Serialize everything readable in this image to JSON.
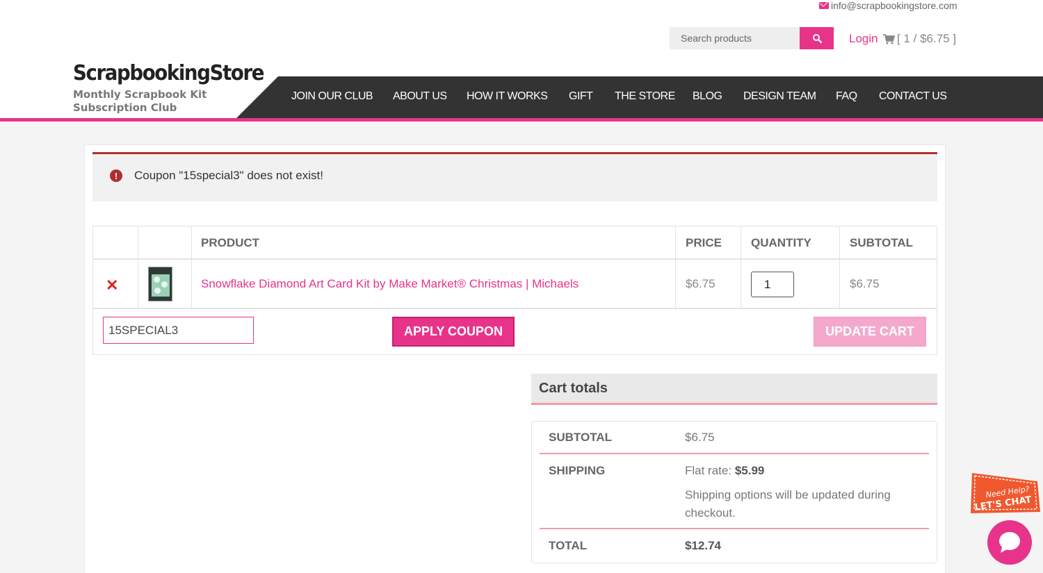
{
  "header": {
    "email": "info@scrapbookingstore.com",
    "search_placeholder": "Search products",
    "login_label": "Login",
    "cart_summary": "[ 1 / $6.75 ]",
    "logo_title": "ScrapbookingStore",
    "logo_subtitle": "Monthly Scrapbook Kit Subscription Club"
  },
  "nav": {
    "items": [
      "JOIN OUR CLUB",
      "ABOUT US",
      "HOW IT WORKS",
      "GIFT",
      "THE STORE",
      "BLOG",
      "DESIGN TEAM",
      "FAQ",
      "CONTACT US"
    ]
  },
  "notice": {
    "error_text": "Coupon \"15special3\" does not exist!"
  },
  "cart": {
    "headers": {
      "product": "PRODUCT",
      "price": "PRICE",
      "quantity": "QUANTITY",
      "subtotal": "SUBTOTAL"
    },
    "item": {
      "name": "Snowflake Diamond Art Card Kit by Make Market® Christmas | Michaels",
      "price": "$6.75",
      "quantity": "1",
      "subtotal": "$6.75"
    },
    "coupon_value": "15SPECIAL3",
    "apply_label": "APPLY COUPON",
    "update_label": "UPDATE CART"
  },
  "totals": {
    "title": "Cart totals",
    "subtotal_label": "SUBTOTAL",
    "subtotal_value": "$6.75",
    "shipping_label": "SHIPPING",
    "shipping_prefix": "Flat rate: ",
    "shipping_amount": "$5.99",
    "shipping_note": "Shipping options will be updated during checkout.",
    "total_label": "TOTAL",
    "total_value": "$12.74"
  },
  "chat": {
    "badge_line1": "Need Help?",
    "badge_line2": "LET'S CHAT"
  },
  "colors": {
    "accent": "#e8338a",
    "nav_bg": "#333333",
    "error": "#b32d2e"
  }
}
